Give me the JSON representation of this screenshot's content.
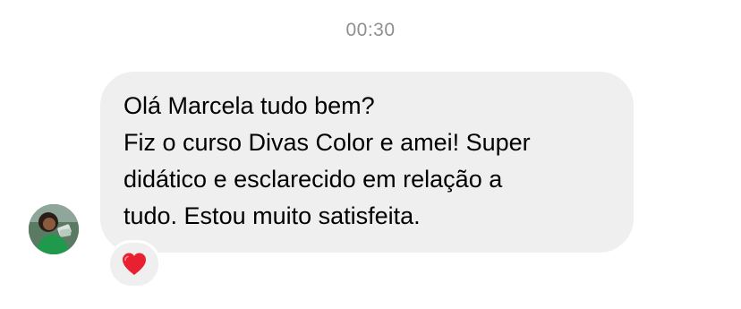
{
  "timestamp": "00:30",
  "message": {
    "lines": [
      "Olá Marcela tudo bem?",
      "Fiz o curso Divas Color e amei! Super",
      "didático e esclarecido em relação a",
      "tudo. Estou muito satisfeita."
    ]
  },
  "reaction": {
    "icon": "heart-icon",
    "color": "#e8202f"
  },
  "avatar": {
    "icon": "sender-avatar"
  },
  "colors": {
    "bubble_bg": "#efefef",
    "timestamp": "#8e8e93",
    "heart": "#e8202f"
  }
}
